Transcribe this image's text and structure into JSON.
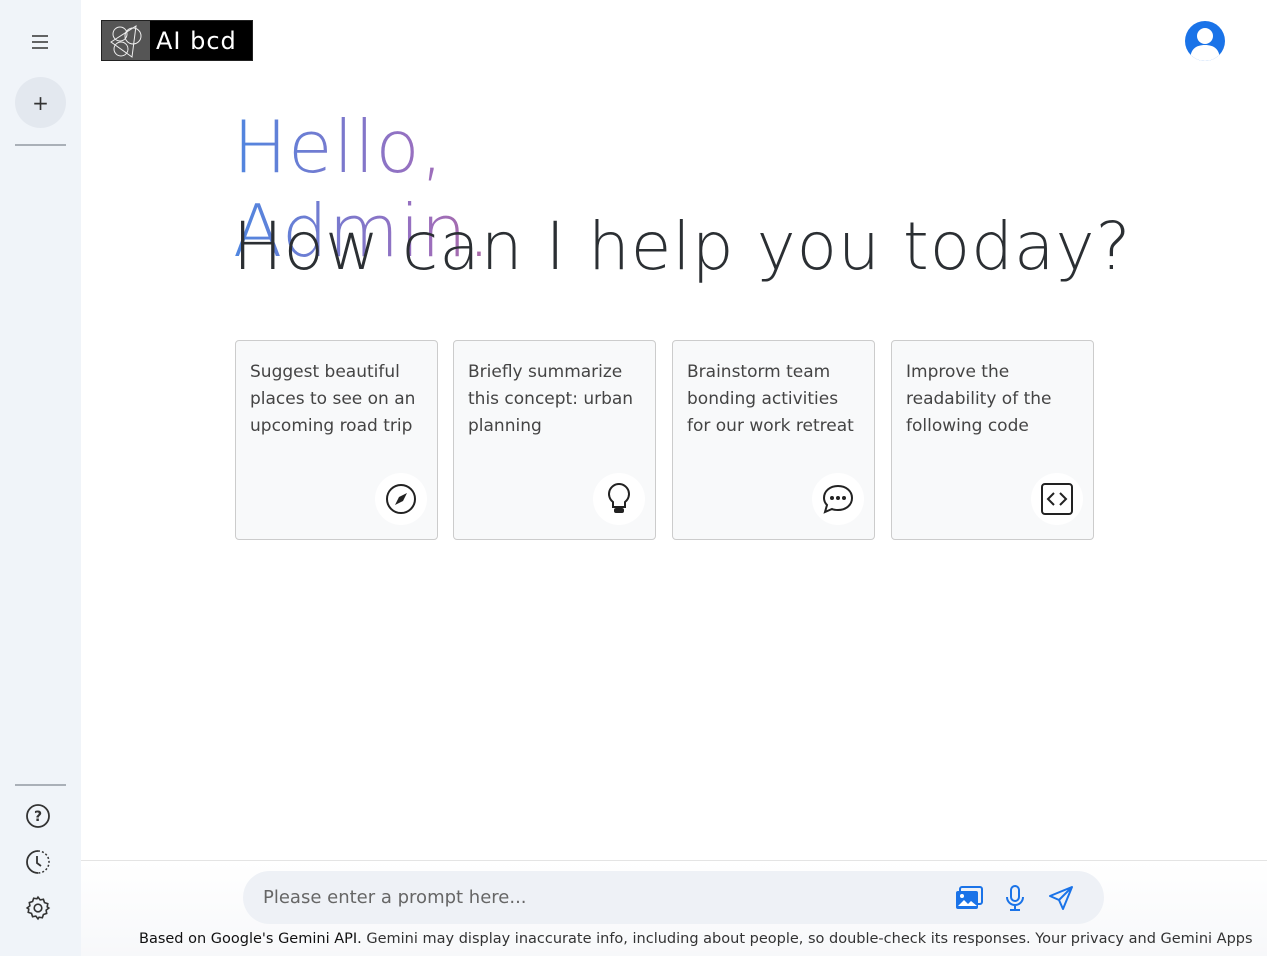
{
  "logo": {
    "text": "AI bcd"
  },
  "greeting": {
    "hello": "Hello, Admin.",
    "subtitle": "How can I help you today?"
  },
  "cards": [
    {
      "text": "Suggest beautiful places to see on an upcoming road trip",
      "icon": "compass-icon"
    },
    {
      "text": "Briefly summarize this concept: urban planning",
      "icon": "lightbulb-icon"
    },
    {
      "text": "Brainstorm team bonding activities for our work retreat",
      "icon": "chat-bubble-icon"
    },
    {
      "text": "Improve the readability of the following code",
      "icon": "code-icon"
    }
  ],
  "prompt": {
    "placeholder": "Please enter a prompt here...",
    "value": ""
  },
  "footer": {
    "bold": "Based on Google's Gemini API.",
    "text": " Gemini may display inaccurate info, including about people, so double-check its responses. Your privacy and Gemini Apps"
  },
  "colors": {
    "accent": "#1a73e8",
    "sidebar": "#f0f4f9"
  }
}
